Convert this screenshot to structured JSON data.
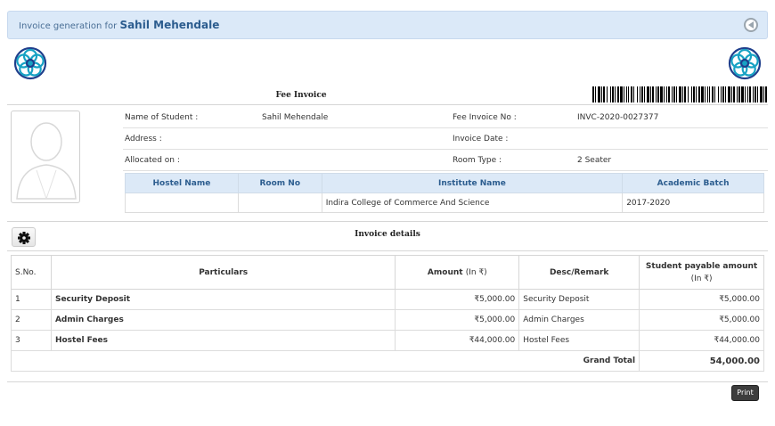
{
  "title": {
    "prefix": "Invoice generation for",
    "student": "Sahil Mehendale"
  },
  "header": {
    "fee_invoice": "Fee Invoice"
  },
  "info": {
    "name_label": "Name of Student :",
    "name_value": "Sahil Mehendale",
    "invoice_no_label": "Fee Invoice No :",
    "invoice_no_value": "INVC-2020-0027377",
    "address_label": "Address :",
    "address_value": "",
    "invoice_date_label": "Invoice Date :",
    "invoice_date_value": "",
    "allocated_label": "Allocated on :",
    "allocated_value": "",
    "room_type_label": "Room Type :",
    "room_type_value": "2 Seater"
  },
  "hostel_table": {
    "headers": [
      "Hostel Name",
      "Room No",
      "Institute Name",
      "Academic Batch"
    ],
    "row": [
      "",
      "",
      "Indira College of Commerce And Science",
      "2017-2020"
    ]
  },
  "details": {
    "title": "Invoice details",
    "headers": {
      "sno": "S.No.",
      "particulars": "Particulars",
      "amount": "Amount",
      "amount_unit": "(In ₹)",
      "desc": "Desc/Remark",
      "payable": "Student payable amount",
      "payable_unit": "(In ₹)"
    },
    "rows": [
      {
        "sno": "1",
        "particular": "Security Deposit",
        "amount": "₹5,000.00",
        "desc": "Security Deposit",
        "payable": "₹5,000.00"
      },
      {
        "sno": "2",
        "particular": "Admin Charges",
        "amount": "₹5,000.00",
        "desc": "Admin Charges",
        "payable": "₹5,000.00"
      },
      {
        "sno": "3",
        "particular": "Hostel Fees",
        "amount": "₹44,000.00",
        "desc": "Hostel Fees",
        "payable": "₹44,000.00"
      }
    ],
    "grand_total_label": "Grand Total",
    "grand_total_value": "54,000.00"
  },
  "buttons": {
    "print": "Print"
  },
  "icons": {
    "back": "back-circle-icon",
    "settings": "gear-icon",
    "logo": "college-logo-icon",
    "photo": "user-silhouette-icon"
  },
  "colors": {
    "title_bar": "#dbe9f8",
    "header_blue": "#2c5d8f",
    "logo_blue": "#1f3f8c",
    "logo_teal": "#17a2c4"
  }
}
